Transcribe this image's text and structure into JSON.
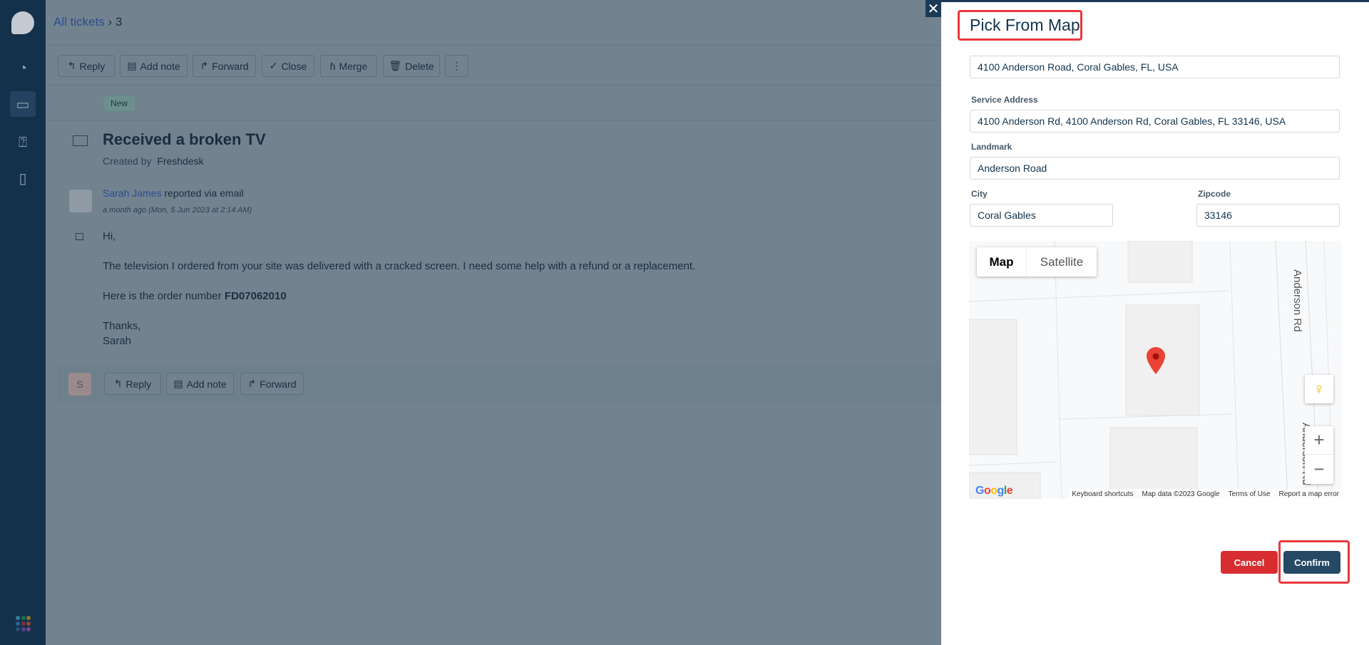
{
  "breadcrumb": {
    "parent": "All tickets",
    "current": "3"
  },
  "toolbar": {
    "reply": "Reply",
    "add_note": "Add note",
    "forward": "Forward",
    "close": "Close",
    "merge": "Merge",
    "delete": "Delete"
  },
  "ticket": {
    "status": "New",
    "title": "Received a broken TV",
    "created_by_label": "Created by",
    "created_by": "Freshdesk"
  },
  "message": {
    "sender": "Sarah James",
    "via": "reported via email",
    "time": "a month ago (Mon, 5 Jun 2023 at 2:14 AM)",
    "greeting": "Hi,",
    "body": "The television I ordered from your site was delivered with a cracked screen. I need some help with a refund or a replacement.",
    "order_prefix": "Here is the order number",
    "order_number": "FD07062010",
    "closing": "Thanks,",
    "signature": "Sarah"
  },
  "reply_bar": {
    "avatar_initial": "S",
    "reply": "Reply",
    "add_note": "Add note",
    "forward": "Forward"
  },
  "panel": {
    "title": "Pick From Map",
    "search_value": "4100 Anderson Road, Coral Gables, FL, USA",
    "service_address_label": "Service Address",
    "service_address": "4100 Anderson Rd, 4100 Anderson Rd, Coral Gables, FL 33146, USA",
    "landmark_label": "Landmark",
    "landmark": "Anderson Road",
    "city_label": "City",
    "city": "Coral Gables",
    "zipcode_label": "Zipcode",
    "zipcode": "33146",
    "cancel": "Cancel",
    "confirm": "Confirm"
  },
  "map": {
    "tab_map": "Map",
    "tab_satellite": "Satellite",
    "road_label": "Anderson Rd",
    "road_label2": "Anderson Rd",
    "logo": "Google",
    "keyboard": "Keyboard shortcuts",
    "map_data": "Map data ©2023 Google",
    "terms": "Terms of Use",
    "report": "Report a map error"
  },
  "colors": {
    "sidebar": "#1b3a55",
    "cancel": "#d72d30",
    "confirm": "#264966",
    "highlight": "#e8373d"
  }
}
